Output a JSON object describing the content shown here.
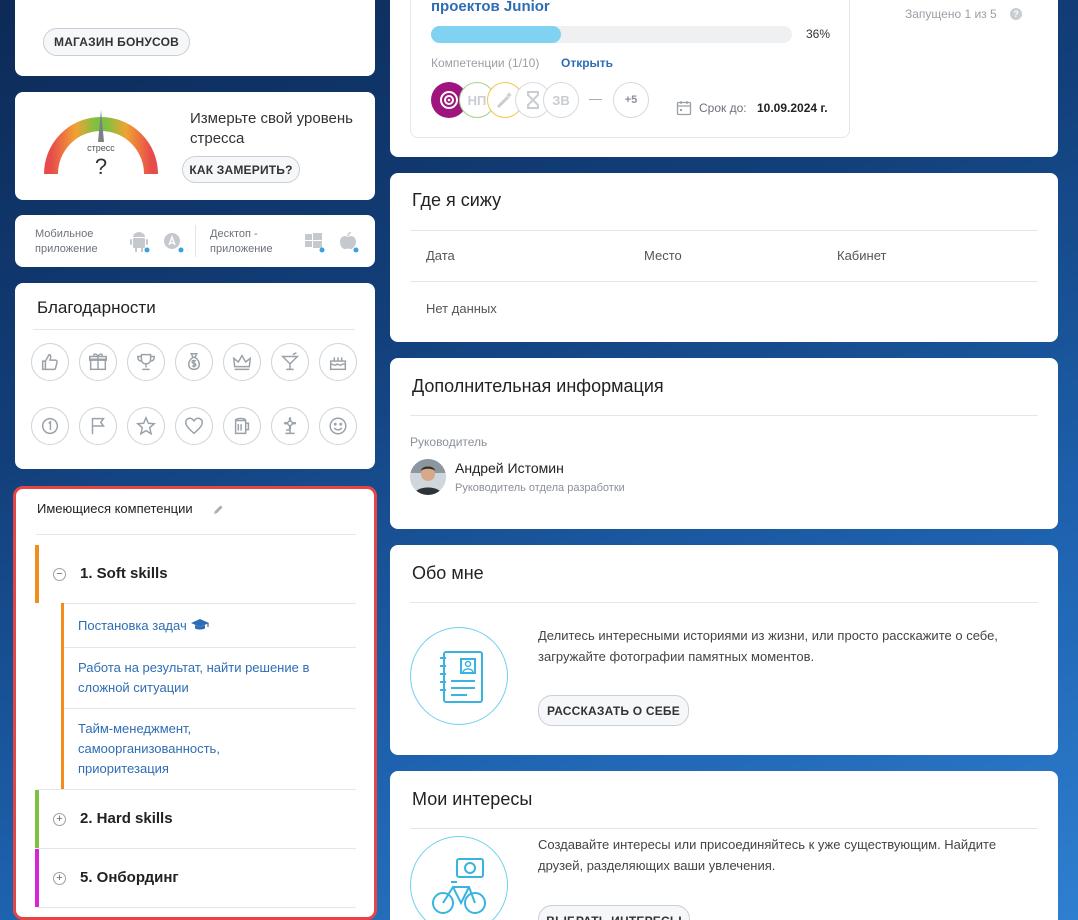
{
  "bonus_card": {
    "shop_button": "МАГАЗИН БОНУСОВ"
  },
  "stress_card": {
    "gauge_label": "стресс",
    "gauge_value": "?",
    "text": "Измерьте свой уровень стресса",
    "button": "КАК ЗАМЕРИТЬ?"
  },
  "apps_card": {
    "mobile_label": "Мобильное приложение",
    "desktop_label": "Десктоп - приложение"
  },
  "thanks_card": {
    "title": "Благодарности",
    "icons": [
      "thumbs-up-icon",
      "gift-icon",
      "trophy-icon",
      "money-bag-icon",
      "crown-icon",
      "cocktail-icon",
      "cake-icon",
      "number-one-icon",
      "flag-icon",
      "star-icon",
      "heart-icon",
      "beer-icon",
      "flower-icon",
      "smile-icon"
    ]
  },
  "competencies_card": {
    "title": "Имеющиеся компетенции",
    "groups": [
      {
        "label": "1. Soft skills",
        "color": "#f28c1a",
        "expanded_sign": "−"
      },
      {
        "label": "2. Hard skills",
        "color": "#7cc242",
        "expanded_sign": "+"
      },
      {
        "label": "5. Онбординг",
        "color": "#d726d7",
        "expanded_sign": "+"
      }
    ],
    "soft_items": [
      "Постановка задач",
      "Работа на результат, найти решение в сложной ситуации",
      "Тайм-менеджмент, самоорганизованность, приоритезация"
    ]
  },
  "course_card": {
    "title": "проектов Junior",
    "progress_percent": 36,
    "progress_text": "36%",
    "competences_label": "Компетенции (1/10)",
    "open_link": "Открыть",
    "chips": [
      "НП",
      "ЗВ"
    ],
    "dash": "—",
    "more": "+5",
    "deadline_label": "Срок до:",
    "deadline_value": "10.09.2024 г.",
    "launched_text": "Запущено 1 из 5",
    "help_icon": "?"
  },
  "seat_card": {
    "title": "Где я сижу",
    "columns": [
      "Дата",
      "Место",
      "Кабинет"
    ],
    "empty": "Нет данных"
  },
  "extra_card": {
    "title": "Дополнительная информация",
    "manager_label": "Руководитель",
    "manager_name": "Андрей Истомин",
    "manager_role": "Руководитель отдела разработки"
  },
  "about_card": {
    "title": "Обо мне",
    "text": "Делитесь интересными историями из жизни, или просто расскажите о себе, загружайте фотографии памятных моментов.",
    "button": "РАССКАЗАТЬ О СЕБЕ"
  },
  "interests_card": {
    "title": "Мои интересы",
    "text": "Создавайте интересы или присоединяйтесь к уже существующим. Найдите друзей, разделяющих ваши увлечения.",
    "button": "ВЫБРАТЬ ИНТЕРЕСЫ"
  }
}
